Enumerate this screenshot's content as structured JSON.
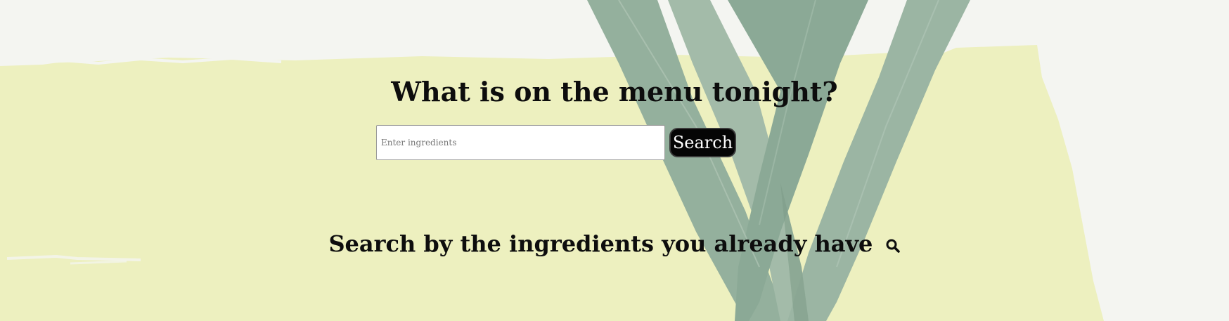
{
  "hero": {
    "title": "What is on the menu tonight?",
    "subtitle": "Search by the ingredients you already have",
    "subtitle_icon": "search-icon"
  },
  "search": {
    "placeholder": "Enter ingredients",
    "value": "",
    "button_label": "Search"
  },
  "colors": {
    "background": "#f4f5f1",
    "brush_stroke": "#edf0bf",
    "leek_green": "#8fae9a",
    "text": "#0d0d0d",
    "button_bg": "#050505",
    "button_text": "#ffffff"
  }
}
